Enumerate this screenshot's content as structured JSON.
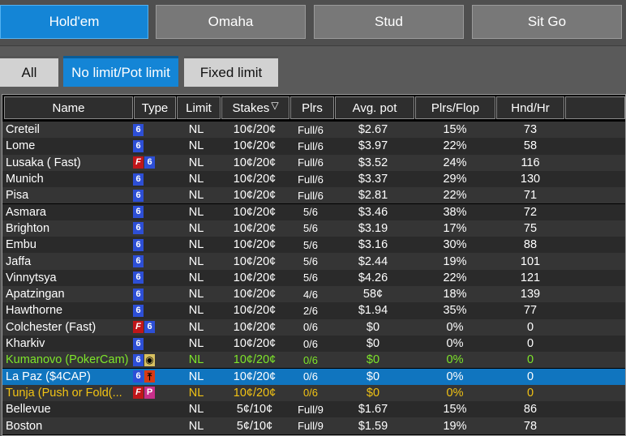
{
  "game_tabs": [
    {
      "label": "Hold'em",
      "active": true
    },
    {
      "label": "Omaha",
      "active": false
    },
    {
      "label": "Stud",
      "active": false
    },
    {
      "label": "Sit Go",
      "active": false
    }
  ],
  "limit_filters": [
    {
      "label": "All",
      "active": false
    },
    {
      "label": "No limit/Pot limit",
      "active": true
    },
    {
      "label": "Fixed limit",
      "active": false
    }
  ],
  "columns": {
    "name": "Name",
    "type": "Type",
    "limit": "Limit",
    "stakes": "Stakes",
    "sort_icon": "▽",
    "plrs": "Plrs",
    "avg_pot": "Avg. pot",
    "plrs_flop": "Plrs/Flop",
    "hnd_hr": "Hnd/Hr"
  },
  "colors": {
    "accent": "#1485d6",
    "highlight_green": "#7ee62a",
    "highlight_yellow": "#f2c314"
  },
  "tables": [
    {
      "name": "Creteil",
      "badges": [
        "6"
      ],
      "limit": "NL",
      "stakes": "10¢/20¢",
      "plrs": "Full/6",
      "avg_pot": "$2.67",
      "plrs_flop": "15%",
      "hnd_hr": "73"
    },
    {
      "name": "Lome",
      "badges": [
        "6"
      ],
      "limit": "NL",
      "stakes": "10¢/20¢",
      "plrs": "Full/6",
      "avg_pot": "$3.97",
      "plrs_flop": "22%",
      "hnd_hr": "58"
    },
    {
      "name": "Lusaka ( Fast)",
      "badges": [
        "F",
        "6"
      ],
      "limit": "NL",
      "stakes": "10¢/20¢",
      "plrs": "Full/6",
      "avg_pot": "$3.52",
      "plrs_flop": "24%",
      "hnd_hr": "116"
    },
    {
      "name": "Munich",
      "badges": [
        "6"
      ],
      "limit": "NL",
      "stakes": "10¢/20¢",
      "plrs": "Full/6",
      "avg_pot": "$3.37",
      "plrs_flop": "29%",
      "hnd_hr": "130"
    },
    {
      "name": "Pisa",
      "badges": [
        "6"
      ],
      "limit": "NL",
      "stakes": "10¢/20¢",
      "plrs": "Full/6",
      "avg_pot": "$2.81",
      "plrs_flop": "22%",
      "hnd_hr": "71"
    },
    {
      "name": "Asmara",
      "badges": [
        "6"
      ],
      "limit": "NL",
      "stakes": "10¢/20¢",
      "plrs": "5/6",
      "avg_pot": "$3.46",
      "plrs_flop": "38%",
      "hnd_hr": "72"
    },
    {
      "name": "Brighton",
      "badges": [
        "6"
      ],
      "limit": "NL",
      "stakes": "10¢/20¢",
      "plrs": "5/6",
      "avg_pot": "$3.19",
      "plrs_flop": "17%",
      "hnd_hr": "75"
    },
    {
      "name": "Embu",
      "badges": [
        "6"
      ],
      "limit": "NL",
      "stakes": "10¢/20¢",
      "plrs": "5/6",
      "avg_pot": "$3.16",
      "plrs_flop": "30%",
      "hnd_hr": "88"
    },
    {
      "name": "Jaffa",
      "badges": [
        "6"
      ],
      "limit": "NL",
      "stakes": "10¢/20¢",
      "plrs": "5/6",
      "avg_pot": "$2.44",
      "plrs_flop": "19%",
      "hnd_hr": "101"
    },
    {
      "name": "Vinnytsya",
      "badges": [
        "6"
      ],
      "limit": "NL",
      "stakes": "10¢/20¢",
      "plrs": "5/6",
      "avg_pot": "$4.26",
      "plrs_flop": "22%",
      "hnd_hr": "121"
    },
    {
      "name": "Apatzingan",
      "badges": [
        "6"
      ],
      "limit": "NL",
      "stakes": "10¢/20¢",
      "plrs": "4/6",
      "avg_pot": "58¢",
      "plrs_flop": "18%",
      "hnd_hr": "139"
    },
    {
      "name": "Hawthorne",
      "badges": [
        "6"
      ],
      "limit": "NL",
      "stakes": "10¢/20¢",
      "plrs": "2/6",
      "avg_pot": "$1.94",
      "plrs_flop": "35%",
      "hnd_hr": "77"
    },
    {
      "name": "Colchester (Fast)",
      "badges": [
        "F",
        "6"
      ],
      "limit": "NL",
      "stakes": "10¢/20¢",
      "plrs": "0/6",
      "avg_pot": "$0",
      "plrs_flop": "0%",
      "hnd_hr": "0"
    },
    {
      "name": "Kharkiv",
      "badges": [
        "6"
      ],
      "limit": "NL",
      "stakes": "10¢/20¢",
      "plrs": "0/6",
      "avg_pot": "$0",
      "plrs_flop": "0%",
      "hnd_hr": "0"
    },
    {
      "name": "Kumanovo (PokerCam)",
      "badges": [
        "6",
        "cam"
      ],
      "limit": "NL",
      "stakes": "10¢/20¢",
      "plrs": "0/6",
      "avg_pot": "$0",
      "plrs_flop": "0%",
      "hnd_hr": "0",
      "color": "green"
    },
    {
      "name": "La Paz ($4CAP)",
      "badges": [
        "6",
        "cap"
      ],
      "limit": "NL",
      "stakes": "10¢/20¢",
      "plrs": "0/6",
      "avg_pot": "$0",
      "plrs_flop": "0%",
      "hnd_hr": "0",
      "selected": true
    },
    {
      "name": "Tunja (Push or Fold(...",
      "badges": [
        "F",
        "P"
      ],
      "limit": "NL",
      "stakes": "10¢/20¢",
      "plrs": "0/6",
      "avg_pot": "$0",
      "plrs_flop": "0%",
      "hnd_hr": "0",
      "color": "yellow"
    },
    {
      "name": "Bellevue",
      "badges": [],
      "limit": "NL",
      "stakes": "5¢/10¢",
      "plrs": "Full/9",
      "avg_pot": "$1.67",
      "plrs_flop": "15%",
      "hnd_hr": "86"
    },
    {
      "name": "Boston",
      "badges": [],
      "limit": "NL",
      "stakes": "5¢/10¢",
      "plrs": "Full/9",
      "avg_pot": "$1.59",
      "plrs_flop": "19%",
      "hnd_hr": "78"
    }
  ]
}
